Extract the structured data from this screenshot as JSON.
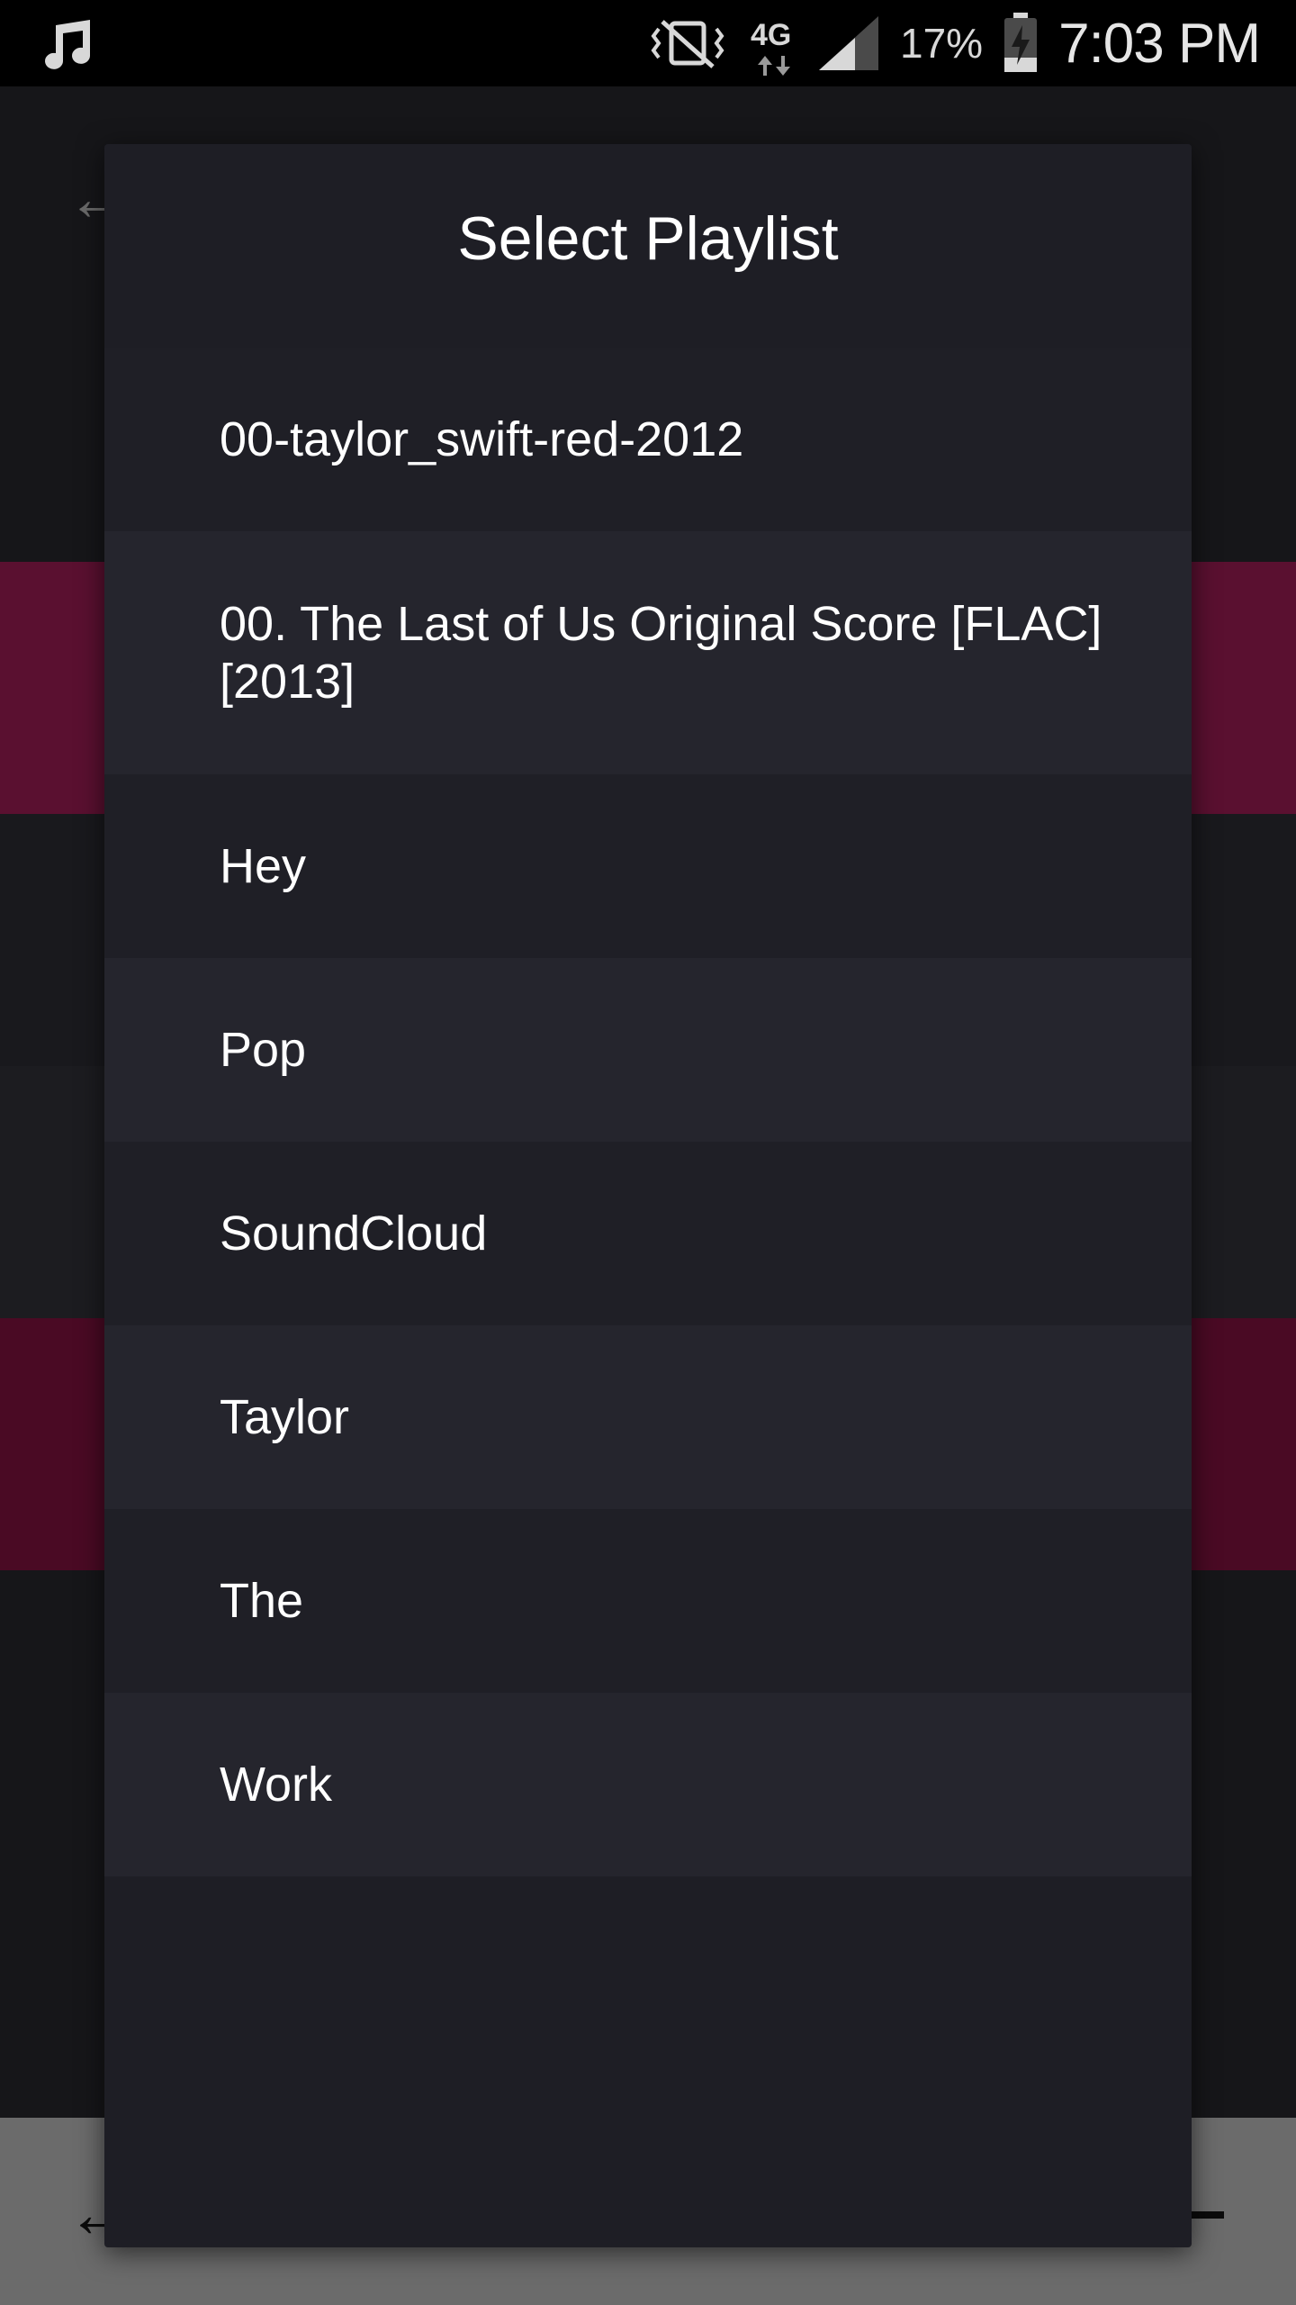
{
  "status_bar": {
    "battery_percent": "17%",
    "time": "7:03 PM",
    "network_label": "4G",
    "icons": [
      "music-note-icon",
      "vibrate-silent-icon",
      "network-4g-icon",
      "signal-icon",
      "battery-charging-icon"
    ]
  },
  "background_app": {
    "back_icon": "arrow-left-icon",
    "accent_color": "#5a1030"
  },
  "dialog": {
    "title": "Select Playlist",
    "playlists": [
      {
        "label": "00-taylor_swift-red-2012"
      },
      {
        "label": "00. The Last of Us Original Score [FLAC] [2013]"
      },
      {
        "label": "Hey"
      },
      {
        "label": "Pop"
      },
      {
        "label": "SoundCloud"
      },
      {
        "label": "Taylor"
      },
      {
        "label": "The"
      },
      {
        "label": "Work"
      }
    ]
  }
}
